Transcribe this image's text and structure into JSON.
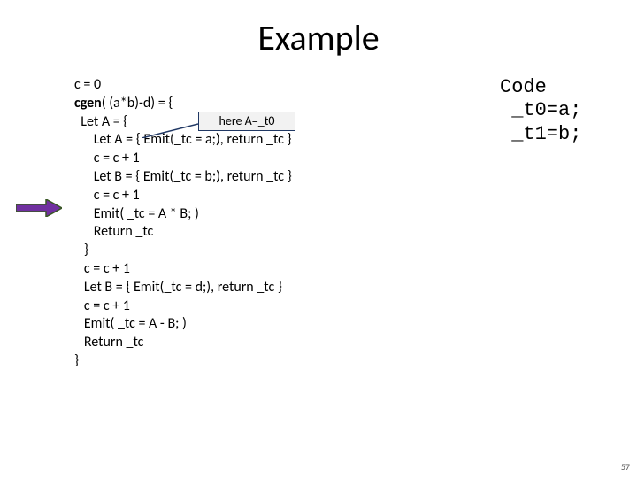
{
  "title": "Example",
  "code_left": {
    "l0": "c = 0",
    "l1_pre": "cgen",
    "l1_post": "( (a*b)-d) = {",
    "l2": "  Let A = {",
    "l3": "      Let A = { Emit(_tc = a;), return _tc }",
    "l4": "      c = c + 1",
    "l5": "      Let B = { Emit(_tc = b;), return _tc }",
    "l6": "      c = c + 1",
    "l7": "      Emit( _tc = A * B; )",
    "l8": "      Return _tc",
    "l9": "   }",
    "l10": "   c = c + 1",
    "l11": "   Let B = { Emit(_tc = d;), return _tc }",
    "l12": "   c = c + 1",
    "l13": "   Emit( _tc = A - B; )",
    "l14": "   Return _tc",
    "l15": "}"
  },
  "callout": "here A=_t0",
  "code_right": {
    "heading": "Code",
    "r1": " _t0=a;",
    "r2": " _t1=b;"
  },
  "page_number": "57",
  "arrow_fill": "#7030a0",
  "arrow_stroke": "#385723"
}
